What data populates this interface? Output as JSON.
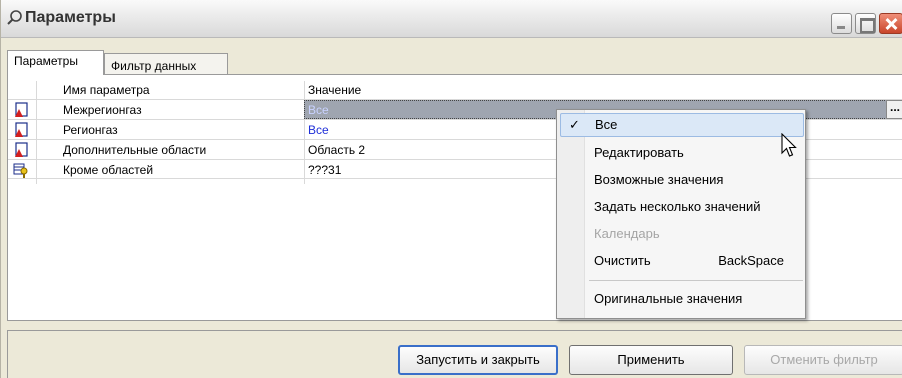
{
  "window": {
    "title": "Параметры",
    "title_icon": "magnifier-icon"
  },
  "tabs": [
    {
      "label": "Параметры",
      "active": true
    },
    {
      "label": "Фильтр данных",
      "active": false
    }
  ],
  "grid": {
    "columns": [
      "Имя параметра",
      "Значение"
    ],
    "rows": [
      {
        "icon": "parameter-pdf-icon",
        "name": "Межрегионгаз",
        "value": "Все",
        "selected": true
      },
      {
        "icon": "parameter-pdf-icon",
        "name": "Регионгаз",
        "value": "Все"
      },
      {
        "icon": "parameter-pdf-icon",
        "name": "Дополнительные области",
        "value": "Область 2"
      },
      {
        "icon": "parameter-key-icon",
        "name": "Кроме областей",
        "value": "???31"
      }
    ],
    "ellipsis_label": "..."
  },
  "context_menu": {
    "items": [
      {
        "label": "Все",
        "checked": true,
        "hover": true
      },
      {
        "label": "Редактировать"
      },
      {
        "label": "Возможные значения"
      },
      {
        "label": "Задать несколько значений"
      },
      {
        "label": "Календарь",
        "disabled": true
      },
      {
        "label": "Очистить",
        "shortcut": "BackSpace"
      },
      {
        "label": "Оригинальные значения"
      }
    ]
  },
  "buttons": {
    "run_close": "Запустить и закрыть",
    "apply": "Применить",
    "cancel_filter": "Отменить фильтр"
  },
  "colors": {
    "blue_value": "#1f2fd8",
    "menu_hover": "#dbe8f7"
  }
}
